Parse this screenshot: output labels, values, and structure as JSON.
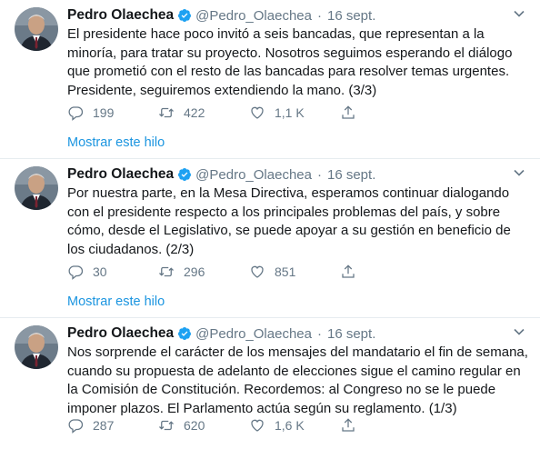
{
  "tweets": [
    {
      "name": "Pedro Olaechea",
      "handle": "@Pedro_Olaechea",
      "date": "16 sept.",
      "text": "El presidente hace poco invitó a seis bancadas, que representan a la minoría, para tratar su proyecto. Nosotros seguimos esperando el diálogo que prometió con el resto de las bancadas para resolver temas urgentes. Presidente, seguiremos extendiendo la mano. (3/3)",
      "replies": "199",
      "retweets": "422",
      "likes": "1,1 K",
      "thread_link": "Mostrar este hilo"
    },
    {
      "name": "Pedro Olaechea",
      "handle": "@Pedro_Olaechea",
      "date": "16 sept.",
      "text": "Por nuestra parte, en la Mesa Directiva, esperamos continuar dialogando con el presidente respecto a los principales problemas del país, y sobre cómo, desde el Legislativo, se puede apoyar a su gestión en beneficio de los ciudadanos. (2/3)",
      "replies": "30",
      "retweets": "296",
      "likes": "851",
      "thread_link": "Mostrar este hilo"
    },
    {
      "name": "Pedro Olaechea",
      "handle": "@Pedro_Olaechea",
      "date": "16 sept.",
      "text": "Nos sorprende el carácter de los mensajes del mandatario el fin de semana, cuando su propuesta de adelanto de elecciones sigue el camino regular en la Comisión de Constitución. Recordemos: al Congreso no se le puede imponer plazos. El Parlamento actúa según su reglamento. (1/3)",
      "replies": "287",
      "retweets": "620",
      "likes": "1,6 K"
    }
  ],
  "colors": {
    "accent": "#1b95e0",
    "secondary_text": "#657786",
    "divider": "#e6ecf0"
  },
  "icons": {
    "verified": "verified-badge-icon",
    "caret": "chevron-down-icon",
    "reply": "reply-icon",
    "retweet": "retweet-icon",
    "like": "heart-icon",
    "share": "share-icon"
  }
}
